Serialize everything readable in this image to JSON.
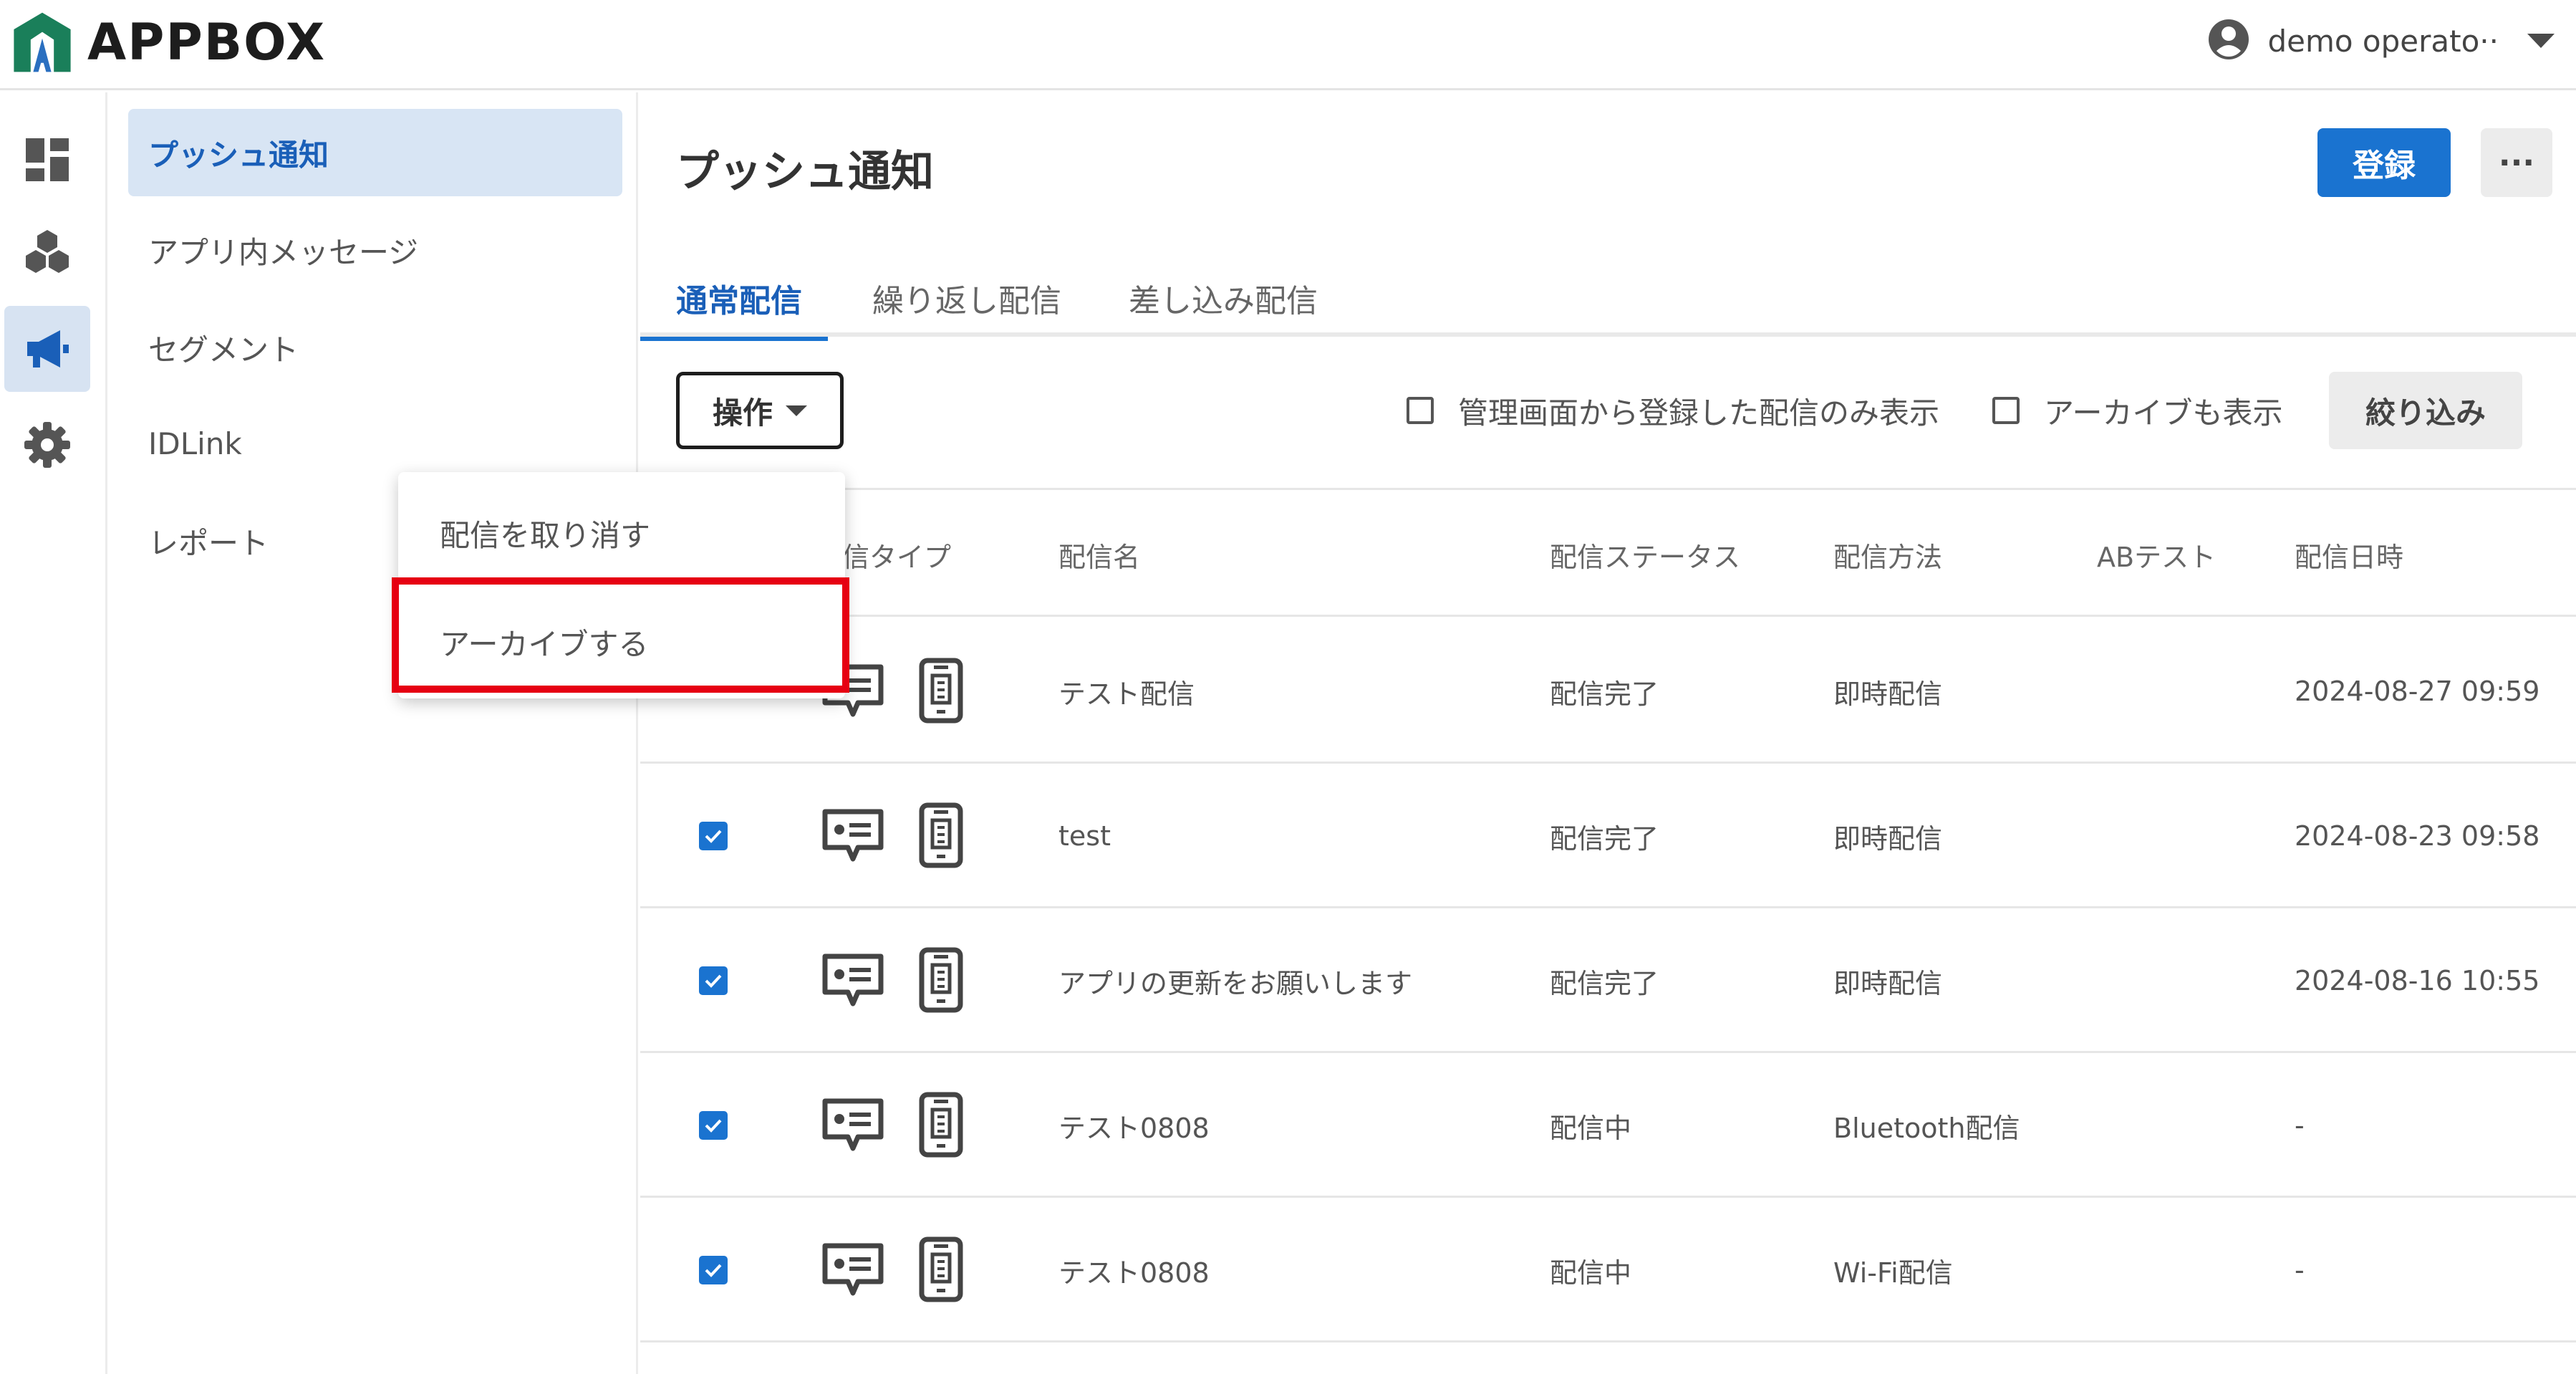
{
  "app": {
    "name": "APPBOX"
  },
  "user": {
    "name": "demo operato··"
  },
  "rail": [
    {
      "icon": "dashboard-icon",
      "active": false
    },
    {
      "icon": "apps-icon",
      "active": false
    },
    {
      "icon": "megaphone-icon",
      "active": true
    },
    {
      "icon": "gear-icon",
      "active": false
    }
  ],
  "sidenav": {
    "items": [
      {
        "label": "プッシュ通知",
        "active": true
      },
      {
        "label": "アプリ内メッセージ",
        "active": false
      },
      {
        "label": "セグメント",
        "active": false
      },
      {
        "label": "IDLink",
        "active": false
      },
      {
        "label": "レポート",
        "active": false
      }
    ]
  },
  "main": {
    "title": "プッシュ通知",
    "register_label": "登録",
    "more_label": "···",
    "tabs": [
      {
        "label": "通常配信",
        "active": true
      },
      {
        "label": "繰り返し配信",
        "active": false
      },
      {
        "label": "差し込み配信",
        "active": false
      }
    ],
    "ops_label": "操作",
    "filters": {
      "admin_only_label": "管理画面から登録した配信のみ表示",
      "admin_only_checked": false,
      "show_archive_label": "アーカイブも表示",
      "show_archive_checked": false,
      "button_label": "絞り込み"
    },
    "table": {
      "columns": {
        "type": "信タイプ",
        "name": "配信名",
        "status": "配信ステータス",
        "method": "配信方法",
        "abtest": "ABテスト",
        "datetime": "配信日時"
      },
      "rows": [
        {
          "checked": true,
          "name": "テスト配信",
          "status": "配信完了",
          "method": "即時配信",
          "abtest": "",
          "datetime": "2024-08-27 09:59"
        },
        {
          "checked": true,
          "name": "test",
          "status": "配信完了",
          "method": "即時配信",
          "abtest": "",
          "datetime": "2024-08-23 09:58"
        },
        {
          "checked": true,
          "name": "アプリの更新をお願いします",
          "status": "配信完了",
          "method": "即時配信",
          "abtest": "",
          "datetime": "2024-08-16 10:55"
        },
        {
          "checked": true,
          "name": "テスト0808",
          "status": "配信中",
          "method": "Bluetooth配信",
          "abtest": "",
          "datetime": "-"
        },
        {
          "checked": true,
          "name": "テスト0808",
          "status": "配信中",
          "method": "Wi-Fi配信",
          "abtest": "",
          "datetime": "-"
        }
      ]
    }
  },
  "dropdown": {
    "items": [
      {
        "label": "配信を取り消す"
      },
      {
        "label": "アーカイブする",
        "highlighted": true
      }
    ]
  },
  "colors": {
    "accent": "#1a73d0",
    "highlight": "#e60012",
    "logo_green": "#1a7f5a",
    "logo_blue": "#2a6fc0"
  }
}
